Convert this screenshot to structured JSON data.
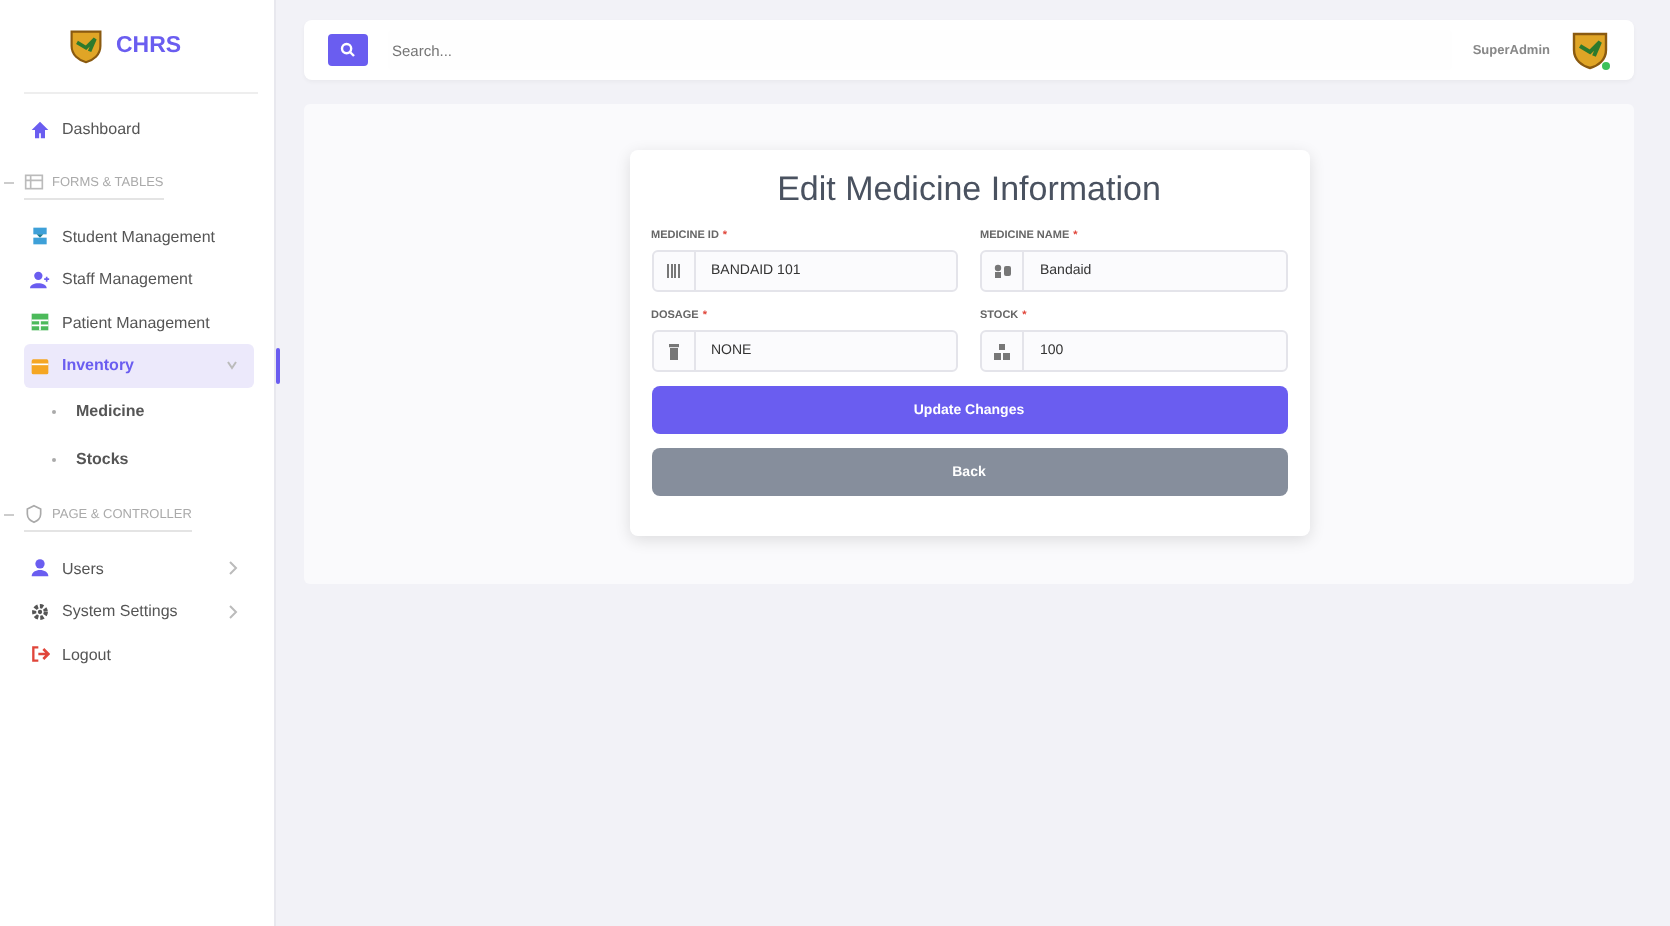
{
  "brand": {
    "name": "CHRS"
  },
  "sidebar": {
    "items": [
      {
        "kind": "link",
        "label": "Dashboard",
        "selected": false
      },
      {
        "kind": "section",
        "label": "FORMS & TABLES"
      },
      {
        "kind": "link",
        "label": "Student Management",
        "selected": false
      },
      {
        "kind": "link",
        "label": "Staff Management",
        "selected": false
      },
      {
        "kind": "link",
        "label": "Patient Management",
        "selected": false
      },
      {
        "kind": "link",
        "label": "Inventory",
        "selected": true,
        "expanded": true,
        "children": [
          {
            "label": "Medicine",
            "selected": false
          },
          {
            "label": "Stocks",
            "selected": false
          }
        ]
      },
      {
        "kind": "section",
        "label": "PAGE & CONTROLLER"
      },
      {
        "kind": "link",
        "label": "Users",
        "selected": false,
        "expanded": false
      },
      {
        "kind": "link",
        "label": "System Settings",
        "selected": false,
        "expanded": false
      },
      {
        "kind": "link",
        "label": "Logout",
        "selected": false
      }
    ]
  },
  "topbar": {
    "search": {
      "placeholder": "Search..."
    },
    "user": {
      "name": "SuperAdmin",
      "online": true
    }
  },
  "form": {
    "title": "Edit Medicine Information",
    "fields": [
      {
        "label": "MEDICINE ID",
        "required_mark": "*",
        "value": "BANDAID 101"
      },
      {
        "label": "MEDICINE NAME",
        "required_mark": "*",
        "value": "Bandaid"
      },
      {
        "label": "DOSAGE",
        "required_mark": "*",
        "value": "NONE"
      },
      {
        "label": "STOCK",
        "required_mark": "*",
        "value": "100"
      }
    ],
    "buttons": [
      {
        "label": "Update Changes",
        "kind": "primary"
      },
      {
        "label": "Back",
        "kind": "secondary"
      }
    ]
  }
}
